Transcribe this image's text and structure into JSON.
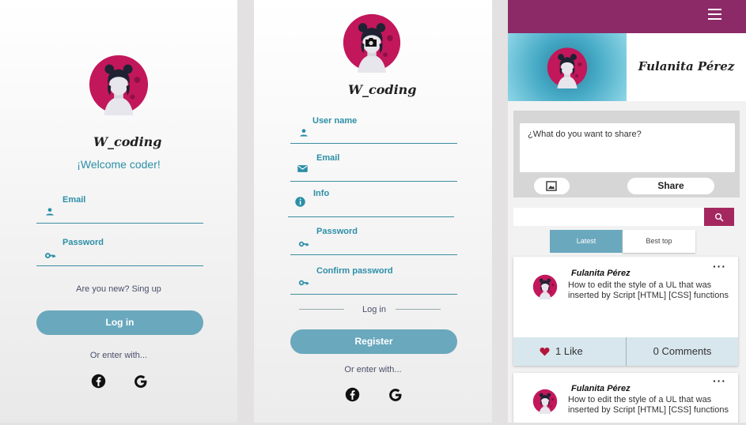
{
  "login": {
    "brand": "W_coding",
    "welcome": "¡Welcome coder!",
    "email_label": "Email",
    "password_label": "Password",
    "signup_text": "Are you new? Sing up",
    "login_button": "Log in",
    "or_enter": "Or enter with..."
  },
  "register": {
    "brand": "W_coding",
    "username_label": "User name",
    "email_label": "Email",
    "info_label": "Info",
    "password_label": "Password",
    "confirm_label": "Confirm password",
    "login_divider": "Log in",
    "register_button": "Register",
    "or_enter": "Or enter with..."
  },
  "feed": {
    "profile_name": "Fulanita Pérez",
    "share_placeholder": "¿What do you want to share?",
    "share_button": "Share",
    "search_placeholder": "",
    "tabs": [
      "Latest",
      "Best top"
    ],
    "posts": [
      {
        "author": "Fulanita Pérez",
        "text": "How to edit the style of a UL that was inserted by Script [HTML] [CSS] functions",
        "likes": "1 Like",
        "comments": "0 Comments"
      },
      {
        "author": "Fulanita Pérez",
        "text": "How to edit the style of a UL that was inserted by Script [HTML] [CSS] functions"
      }
    ]
  },
  "colors": {
    "teal": "#2c8fa6",
    "button": "#6aa8bd",
    "header": "#8c2a68",
    "search_btn": "#a4285f",
    "avatar_bg": "#c2175b"
  }
}
